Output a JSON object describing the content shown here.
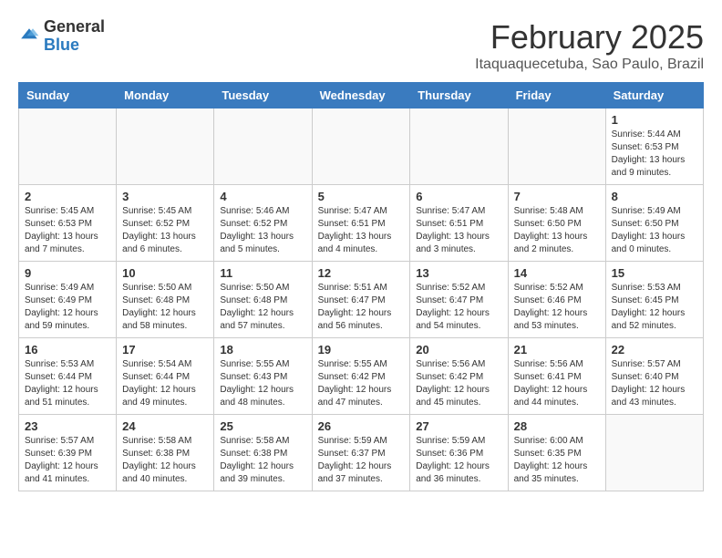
{
  "header": {
    "logo_general": "General",
    "logo_blue": "Blue",
    "month_title": "February 2025",
    "location": "Itaquaquecetuba, Sao Paulo, Brazil"
  },
  "weekdays": [
    "Sunday",
    "Monday",
    "Tuesday",
    "Wednesday",
    "Thursday",
    "Friday",
    "Saturday"
  ],
  "weeks": [
    [
      {
        "day": "",
        "info": ""
      },
      {
        "day": "",
        "info": ""
      },
      {
        "day": "",
        "info": ""
      },
      {
        "day": "",
        "info": ""
      },
      {
        "day": "",
        "info": ""
      },
      {
        "day": "",
        "info": ""
      },
      {
        "day": "1",
        "info": "Sunrise: 5:44 AM\nSunset: 6:53 PM\nDaylight: 13 hours\nand 9 minutes."
      }
    ],
    [
      {
        "day": "2",
        "info": "Sunrise: 5:45 AM\nSunset: 6:53 PM\nDaylight: 13 hours\nand 7 minutes."
      },
      {
        "day": "3",
        "info": "Sunrise: 5:45 AM\nSunset: 6:52 PM\nDaylight: 13 hours\nand 6 minutes."
      },
      {
        "day": "4",
        "info": "Sunrise: 5:46 AM\nSunset: 6:52 PM\nDaylight: 13 hours\nand 5 minutes."
      },
      {
        "day": "5",
        "info": "Sunrise: 5:47 AM\nSunset: 6:51 PM\nDaylight: 13 hours\nand 4 minutes."
      },
      {
        "day": "6",
        "info": "Sunrise: 5:47 AM\nSunset: 6:51 PM\nDaylight: 13 hours\nand 3 minutes."
      },
      {
        "day": "7",
        "info": "Sunrise: 5:48 AM\nSunset: 6:50 PM\nDaylight: 13 hours\nand 2 minutes."
      },
      {
        "day": "8",
        "info": "Sunrise: 5:49 AM\nSunset: 6:50 PM\nDaylight: 13 hours\nand 0 minutes."
      }
    ],
    [
      {
        "day": "9",
        "info": "Sunrise: 5:49 AM\nSunset: 6:49 PM\nDaylight: 12 hours\nand 59 minutes."
      },
      {
        "day": "10",
        "info": "Sunrise: 5:50 AM\nSunset: 6:48 PM\nDaylight: 12 hours\nand 58 minutes."
      },
      {
        "day": "11",
        "info": "Sunrise: 5:50 AM\nSunset: 6:48 PM\nDaylight: 12 hours\nand 57 minutes."
      },
      {
        "day": "12",
        "info": "Sunrise: 5:51 AM\nSunset: 6:47 PM\nDaylight: 12 hours\nand 56 minutes."
      },
      {
        "day": "13",
        "info": "Sunrise: 5:52 AM\nSunset: 6:47 PM\nDaylight: 12 hours\nand 54 minutes."
      },
      {
        "day": "14",
        "info": "Sunrise: 5:52 AM\nSunset: 6:46 PM\nDaylight: 12 hours\nand 53 minutes."
      },
      {
        "day": "15",
        "info": "Sunrise: 5:53 AM\nSunset: 6:45 PM\nDaylight: 12 hours\nand 52 minutes."
      }
    ],
    [
      {
        "day": "16",
        "info": "Sunrise: 5:53 AM\nSunset: 6:44 PM\nDaylight: 12 hours\nand 51 minutes."
      },
      {
        "day": "17",
        "info": "Sunrise: 5:54 AM\nSunset: 6:44 PM\nDaylight: 12 hours\nand 49 minutes."
      },
      {
        "day": "18",
        "info": "Sunrise: 5:55 AM\nSunset: 6:43 PM\nDaylight: 12 hours\nand 48 minutes."
      },
      {
        "day": "19",
        "info": "Sunrise: 5:55 AM\nSunset: 6:42 PM\nDaylight: 12 hours\nand 47 minutes."
      },
      {
        "day": "20",
        "info": "Sunrise: 5:56 AM\nSunset: 6:42 PM\nDaylight: 12 hours\nand 45 minutes."
      },
      {
        "day": "21",
        "info": "Sunrise: 5:56 AM\nSunset: 6:41 PM\nDaylight: 12 hours\nand 44 minutes."
      },
      {
        "day": "22",
        "info": "Sunrise: 5:57 AM\nSunset: 6:40 PM\nDaylight: 12 hours\nand 43 minutes."
      }
    ],
    [
      {
        "day": "23",
        "info": "Sunrise: 5:57 AM\nSunset: 6:39 PM\nDaylight: 12 hours\nand 41 minutes."
      },
      {
        "day": "24",
        "info": "Sunrise: 5:58 AM\nSunset: 6:38 PM\nDaylight: 12 hours\nand 40 minutes."
      },
      {
        "day": "25",
        "info": "Sunrise: 5:58 AM\nSunset: 6:38 PM\nDaylight: 12 hours\nand 39 minutes."
      },
      {
        "day": "26",
        "info": "Sunrise: 5:59 AM\nSunset: 6:37 PM\nDaylight: 12 hours\nand 37 minutes."
      },
      {
        "day": "27",
        "info": "Sunrise: 5:59 AM\nSunset: 6:36 PM\nDaylight: 12 hours\nand 36 minutes."
      },
      {
        "day": "28",
        "info": "Sunrise: 6:00 AM\nSunset: 6:35 PM\nDaylight: 12 hours\nand 35 minutes."
      },
      {
        "day": "",
        "info": ""
      }
    ]
  ]
}
